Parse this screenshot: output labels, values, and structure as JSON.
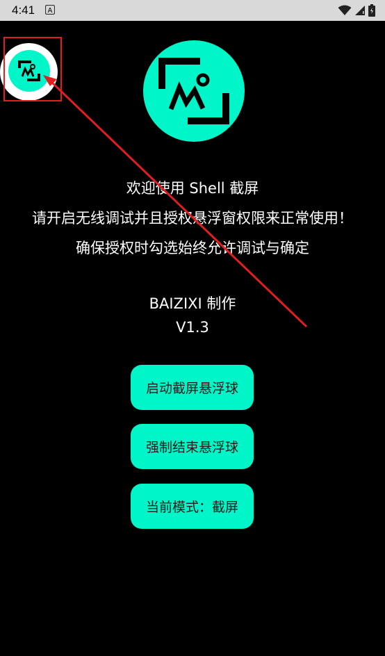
{
  "status_bar": {
    "time": "4:41",
    "notification_icon": "a-letter-icon",
    "icons": [
      "wifi-icon",
      "cellular-signal-icon",
      "battery-icon"
    ],
    "background": "#d9d9d9"
  },
  "floating_ball": {
    "icon": "screenshot-logo-icon",
    "highlight_color": "#e02020"
  },
  "app": {
    "logo_icon": "screenshot-logo-icon",
    "accent_color": "#00f5c8",
    "welcome": "欢迎使用 Shell 截屏",
    "instruction": "请开启无线调试并且授权悬浮窗权限来正常使用！",
    "note": "确保授权时勾选始终允许调试与确定",
    "author": "BAIZIXI 制作",
    "version": "V1.3"
  },
  "buttons": {
    "start_label": "启动截屏悬浮球",
    "stop_label": "强制结束悬浮球",
    "mode_label": "当前模式：截屏"
  },
  "annotation": {
    "arrow_color": "#e02020"
  }
}
